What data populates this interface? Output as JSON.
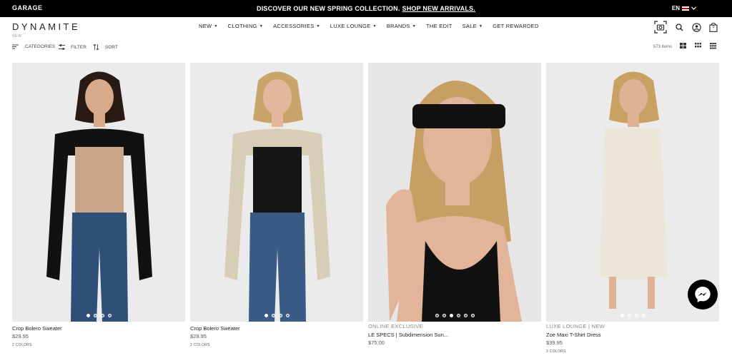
{
  "topbar": {
    "brand": "GARAGE",
    "promo_text": "DISCOVER OUR NEW SPRING COLLECTION.",
    "promo_link": "SHOP NEW ARRIVALS.",
    "language": "EN"
  },
  "header": {
    "logo": "DYNAMITE",
    "logo_sub": "NEW",
    "nav": [
      {
        "label": "NEW",
        "caret": true
      },
      {
        "label": "CLOTHING",
        "caret": true
      },
      {
        "label": "ACCESSORIES",
        "caret": true
      },
      {
        "label": "LUXE LOUNGE",
        "caret": true
      },
      {
        "label": "BRANDS",
        "caret": true
      },
      {
        "label": "THE EDIT",
        "caret": false
      },
      {
        "label": "SALE",
        "caret": true
      },
      {
        "label": "GET REWARDED",
        "caret": false
      }
    ],
    "cart_count": "0"
  },
  "toolbar": {
    "categories": "CATEGORIES",
    "filter": "FILTER",
    "sort": "SORT",
    "item_count": "573 items"
  },
  "products": [
    {
      "badge": "",
      "name": "Crop Bolero Sweater",
      "price": "$29.95",
      "colors": "2 COLORS",
      "dots": 4,
      "active_dot": 0,
      "top": "#111111",
      "inner": "#c9a68a",
      "bottom": "#2f4f78",
      "hair": "#2a1a14",
      "skin": "#d9a98c"
    },
    {
      "badge": "",
      "name": "Crop Bolero Sweater",
      "price": "$29.95",
      "colors": "2 COLORS",
      "dots": 4,
      "active_dot": 0,
      "top": "#d8cdb6",
      "inner": "#151515",
      "bottom": "#3a5b86",
      "hair": "#caa56b",
      "skin": "#e3b79c"
    },
    {
      "badge": "ONLINE EXCLUSIVE",
      "name": "LE SPECS | Subdimension Sun...",
      "price": "$75.00",
      "colors": "",
      "dots": 6,
      "active_dot": 2,
      "top": "#111111",
      "inner": "#111111",
      "bottom": "#111111",
      "hair": "#c89f63",
      "skin": "#e2b59a"
    },
    {
      "badge": "LUXE LOUNGE | NEW",
      "name": "Zoe Maxi T-Shirt Dress",
      "price": "$39.95",
      "colors": "3 COLORS",
      "dots": 4,
      "active_dot": 0,
      "top": "#ece6d8",
      "inner": "#ece6d8",
      "bottom": "#ece6d8",
      "hair": "#c9a062",
      "skin": "#e0b295"
    }
  ]
}
